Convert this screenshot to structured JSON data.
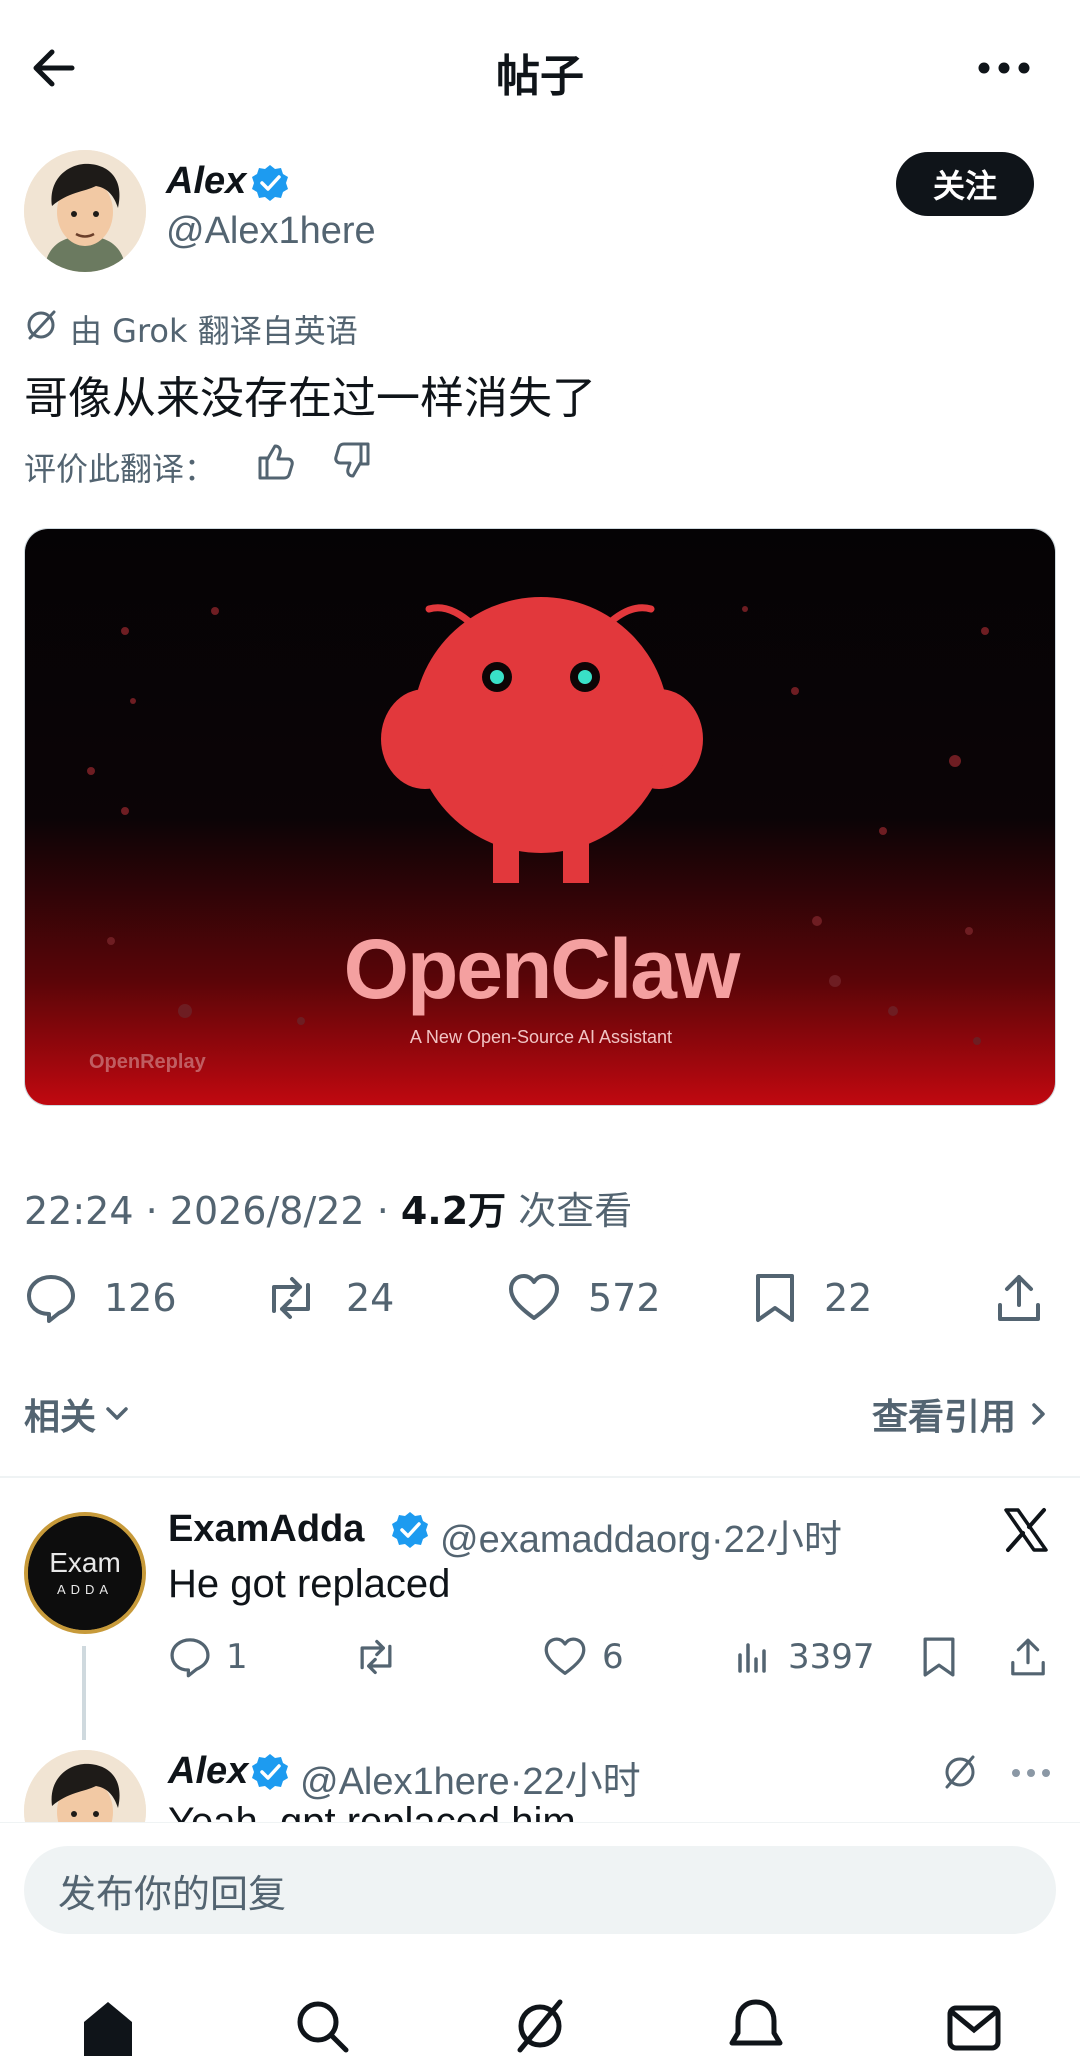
{
  "header": {
    "title": "帖子"
  },
  "post": {
    "author_name": "Alex",
    "author_handle": "@Alex1here",
    "follow_label": "关注",
    "translation_label": "由 Grok 翻译自英语",
    "text": "哥像从来没存在过一样消失了",
    "rate_label": "评价此翻译：",
    "media": {
      "title": "OpenClaw",
      "subtitle": "A New Open-Source AI Assistant",
      "watermark": "OpenReplay"
    },
    "time": "22:24",
    "date": "2026/8/22",
    "views_count": "4.2万",
    "views_label": "次查看",
    "stats": {
      "replies": "126",
      "reposts": "24",
      "likes": "572",
      "bookmarks": "22"
    }
  },
  "sections": {
    "related_label": "相关",
    "quotes_label": "查看引用"
  },
  "replies": [
    {
      "name": "ExamAdda",
      "handle": "@examaddaorg",
      "time": "22小时",
      "text": "He got replaced",
      "avatar_line1": "Exam",
      "avatar_line2": "ADDA",
      "stats": {
        "replies": "1",
        "reposts": "",
        "likes": "6",
        "views": "3397"
      }
    },
    {
      "name": "Alex",
      "handle": "@Alex1here",
      "time": "22小时",
      "text": "Yeah, gpt replaced him"
    }
  ],
  "composer": {
    "placeholder": "发布你的回复"
  },
  "colors": {
    "accent": "#1d9bf0",
    "text": "#0f1419",
    "muted": "#536471",
    "brand_red": "#e2383c"
  },
  "icons": [
    "back-arrow-icon",
    "more-icon",
    "verified-icon",
    "grok-icon",
    "thumbs-up-icon",
    "thumbs-down-icon",
    "reply-icon",
    "repost-icon",
    "like-icon",
    "bookmark-icon",
    "share-icon",
    "chevron-down-icon",
    "chevron-right-icon",
    "x-logo-icon",
    "views-icon",
    "home-icon",
    "search-icon",
    "notifications-icon",
    "messages-icon"
  ]
}
